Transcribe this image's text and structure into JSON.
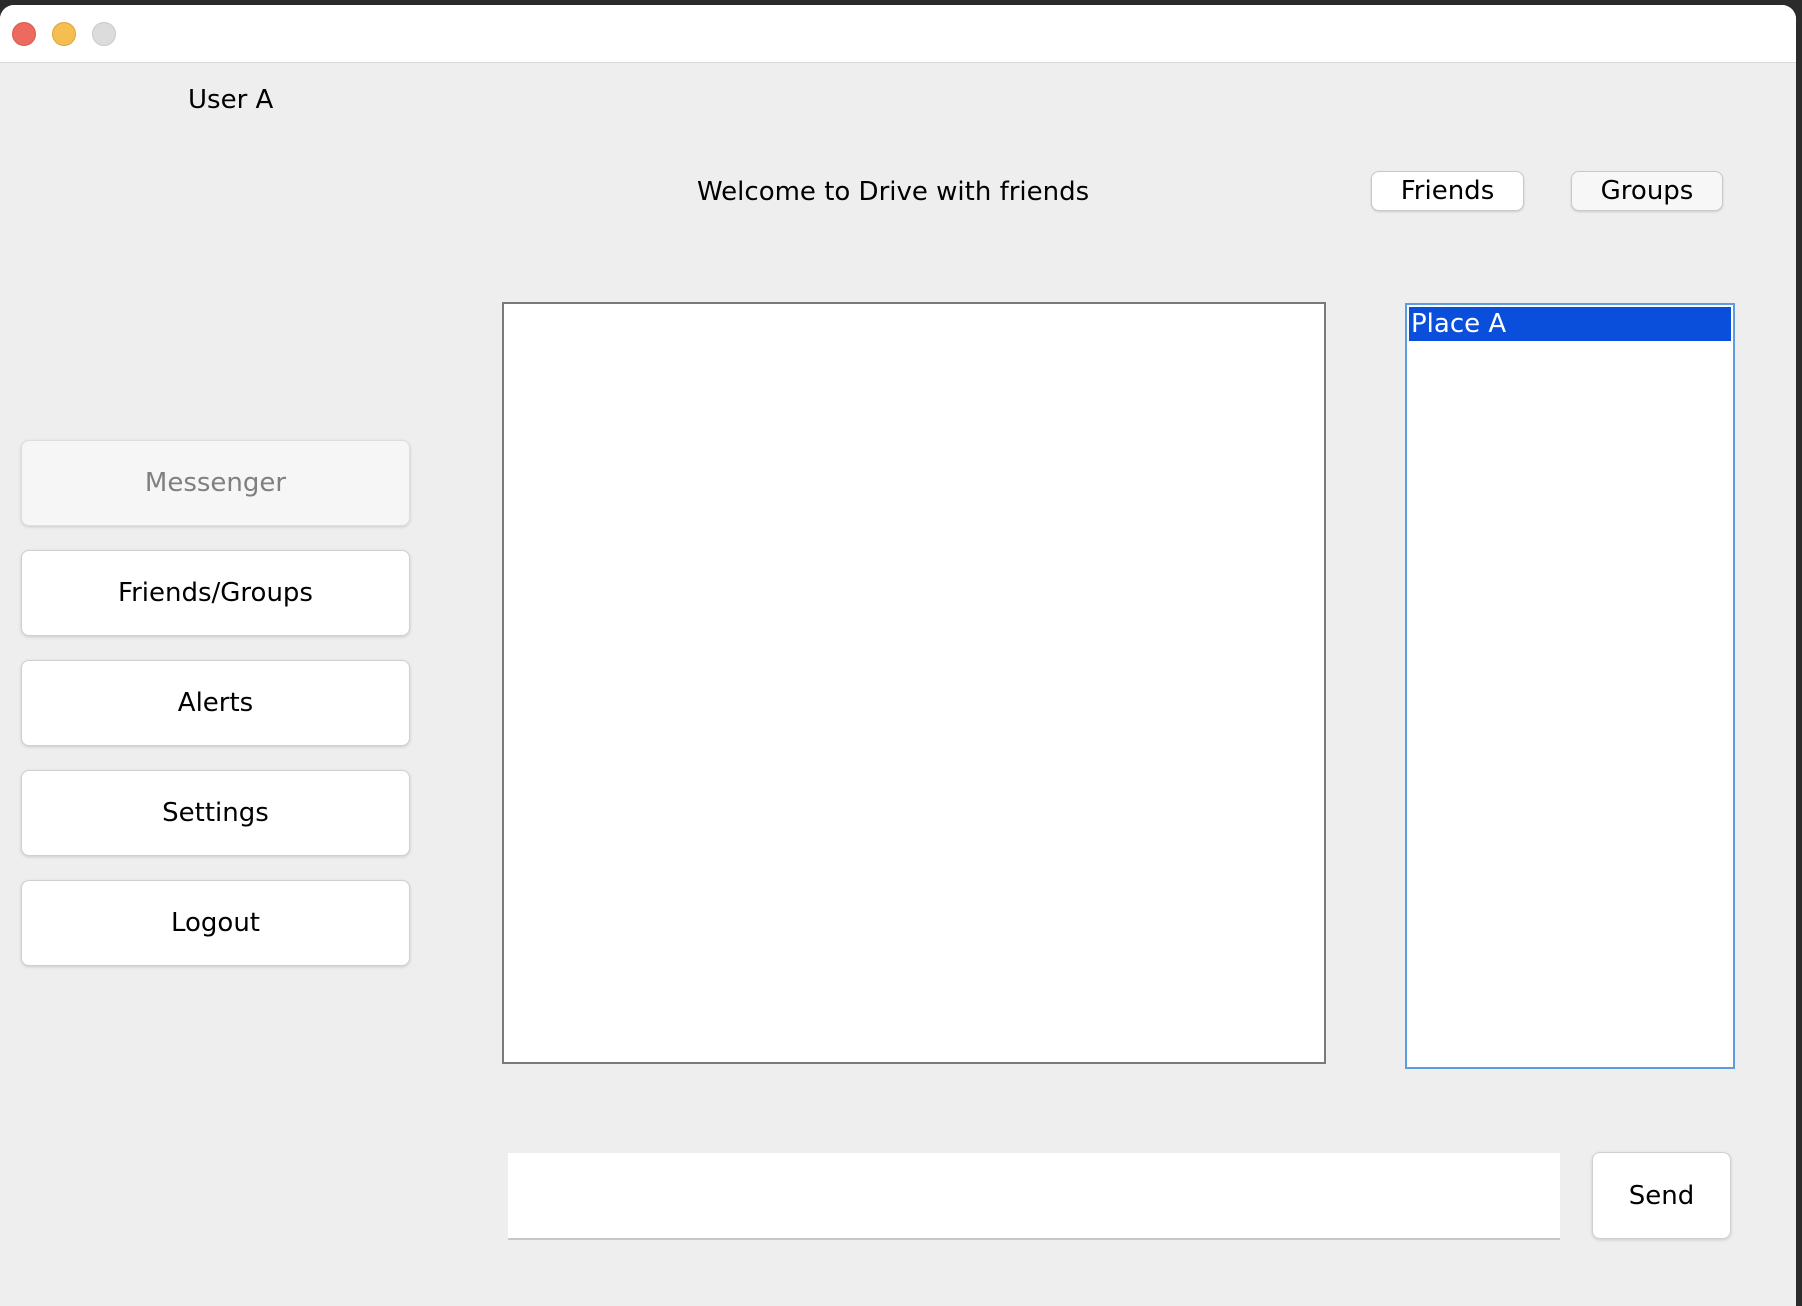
{
  "window": {
    "controls": [
      "close-icon",
      "minimize-icon",
      "maximize-icon"
    ]
  },
  "header": {
    "user": "User A",
    "welcome": "Welcome to Drive with friends",
    "friends_label": "Friends",
    "groups_label": "Groups"
  },
  "sidebar": {
    "items": [
      {
        "label": "Messenger",
        "enabled": false
      },
      {
        "label": "Friends/Groups",
        "enabled": true
      },
      {
        "label": "Alerts",
        "enabled": true
      },
      {
        "label": "Settings",
        "enabled": true
      },
      {
        "label": "Logout",
        "enabled": true
      }
    ]
  },
  "places": {
    "items": [
      "Place A"
    ],
    "selected": "Place A"
  },
  "composer": {
    "input_value": "",
    "send_label": "Send"
  },
  "colors": {
    "selection": "#0a4fdc",
    "list_border": "#5c9ddf",
    "background": "#eeeeee"
  }
}
